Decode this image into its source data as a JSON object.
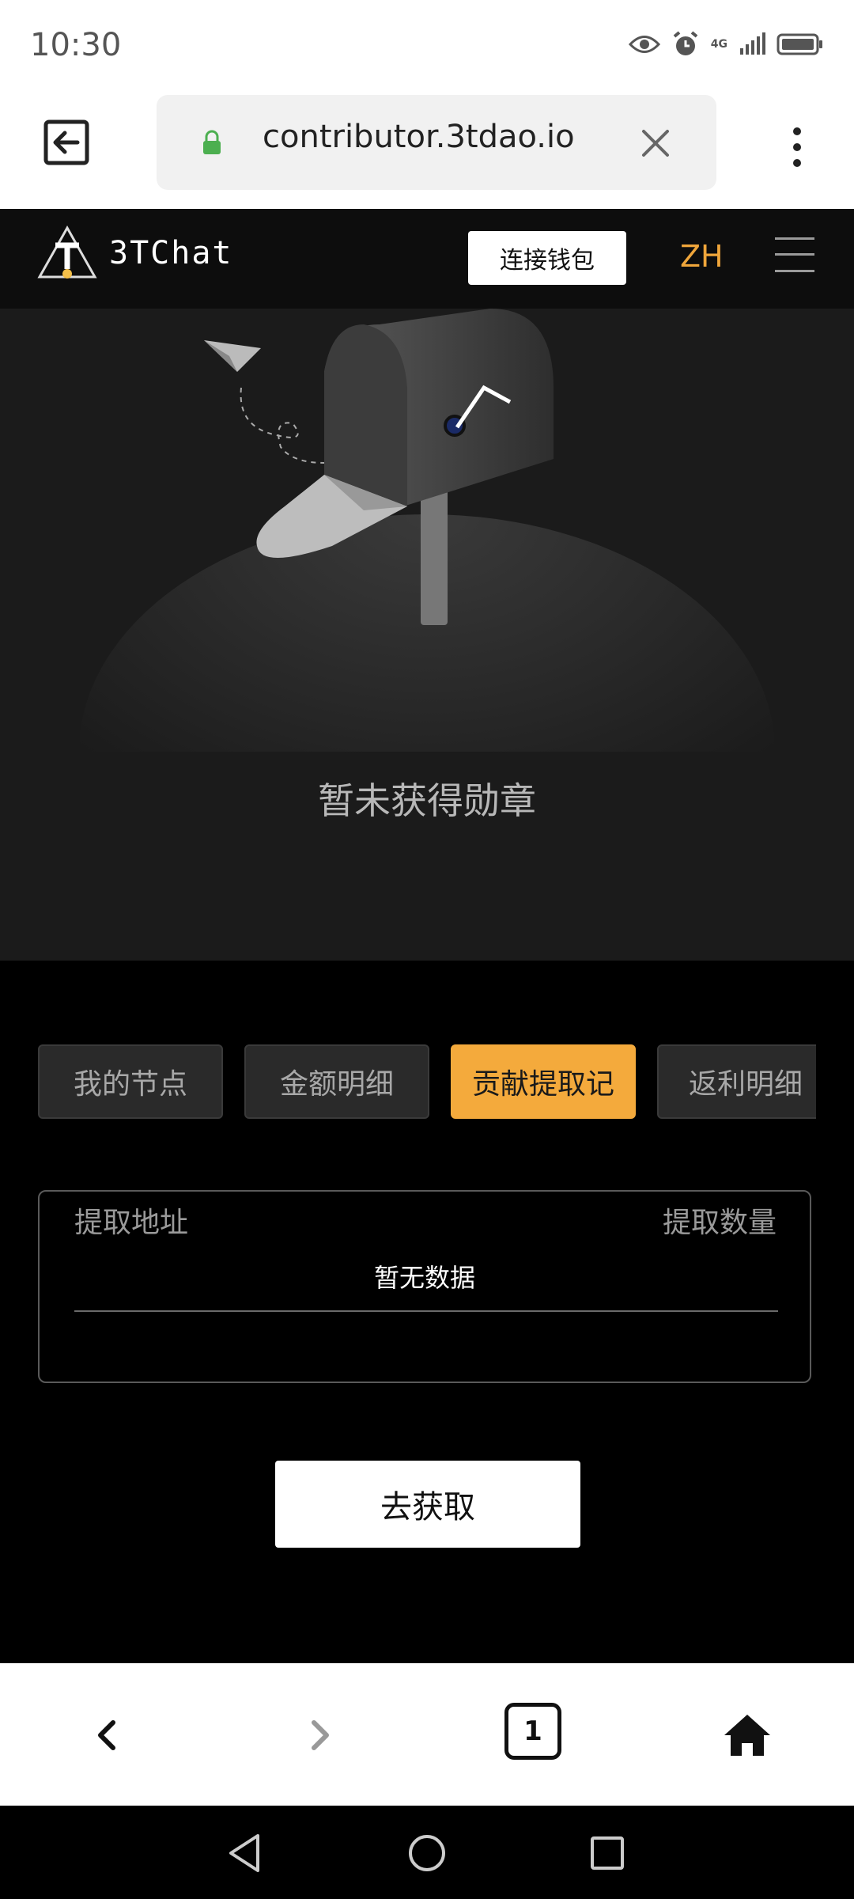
{
  "status_bar": {
    "time": "10:30",
    "network": "4G",
    "icons": [
      "eye-icon",
      "alarm-icon",
      "signal-icon",
      "battery-icon"
    ]
  },
  "browser": {
    "url": "contributor.3tdao.io",
    "tab_count": "1"
  },
  "header": {
    "brand": "3TChat",
    "connect_wallet": "连接钱包",
    "language": "ZH"
  },
  "hero": {
    "empty_text": "暂未获得勋章"
  },
  "tabs": [
    {
      "label": "我的节点",
      "active": false
    },
    {
      "label": "金额明细",
      "active": false
    },
    {
      "label": "贡献提取记",
      "active": true
    },
    {
      "label": "返利明细",
      "active": false
    }
  ],
  "records": {
    "col_address": "提取地址",
    "col_amount": "提取数量",
    "empty": "暂无数据"
  },
  "action": {
    "go_get": "去获取"
  },
  "colors": {
    "accent": "#f4aa3c",
    "lang": "#f0a63b",
    "page_bg": "#000000",
    "hero_bg": "#1b1b1b"
  }
}
